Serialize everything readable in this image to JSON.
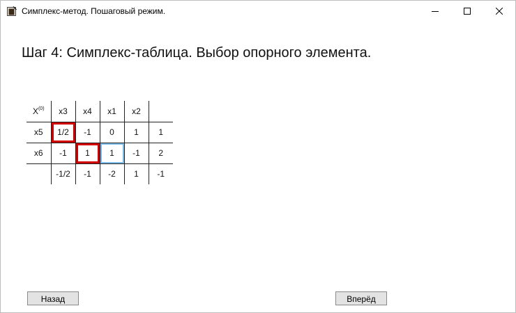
{
  "window": {
    "title": "Симплекс-метод. Пошаговый режим.",
    "icons": {
      "app": "app-icon",
      "minimize": "minimize-icon",
      "maximize": "maximize-icon",
      "close": "close-icon"
    }
  },
  "step_heading": "Шаг 4: Симплекс-таблица. Выбор опорного элемента.",
  "table": {
    "corner_base": "X",
    "corner_sup": "(0)",
    "headers": [
      "x3",
      "x4",
      "x1",
      "x2",
      ""
    ],
    "rows": [
      {
        "label": "x5",
        "cells": [
          "1/2",
          "-1",
          "0",
          "1",
          "1"
        ]
      },
      {
        "label": "x6",
        "cells": [
          "-1",
          "1",
          "1",
          "-1",
          "2"
        ]
      },
      {
        "label": "",
        "cells": [
          "-1/2",
          "-1",
          "-2",
          "1",
          "-1"
        ]
      }
    ],
    "highlight_colors": {
      "pivot_candidate": "#d10000",
      "selected": "#7bbbe8"
    }
  },
  "buttons": {
    "back": "Назад",
    "forward": "Вперёд"
  }
}
